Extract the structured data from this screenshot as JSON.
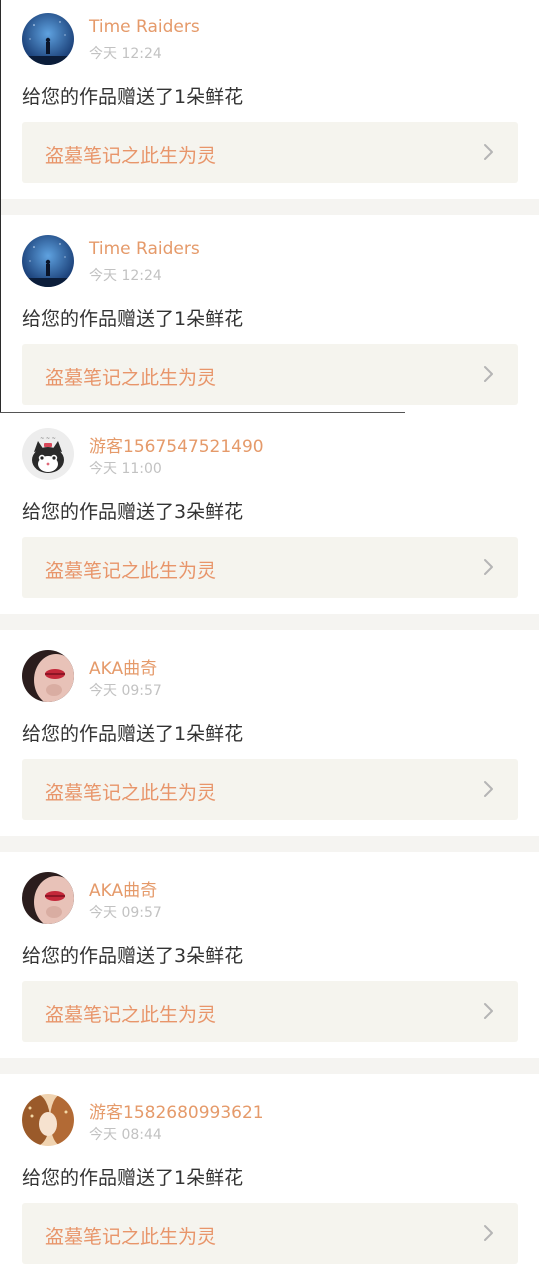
{
  "feed": {
    "items": [
      {
        "user": "Time Raiders",
        "time": "今天 12:24",
        "message": "给您的作品赠送了1朵鲜花",
        "work": "盗墓笔记之此生为灵",
        "avatar_icon": "night-sky-figure-avatar"
      },
      {
        "user": "Time Raiders",
        "time": "今天 12:24",
        "message": "给您的作品赠送了1朵鲜花",
        "work": "盗墓笔记之此生为灵",
        "avatar_icon": "night-sky-figure-avatar"
      },
      {
        "user": "游客1567547521490",
        "time": "今天 11:00",
        "message": "给您的作品赠送了3朵鲜花",
        "work": "盗墓笔记之此生为灵",
        "avatar_icon": "cartoon-cat-avatar"
      },
      {
        "user": "AKA曲奇",
        "time": "今天 09:57",
        "message": "给您的作品赠送了1朵鲜花",
        "work": "盗墓笔记之此生为灵",
        "avatar_icon": "lips-avatar"
      },
      {
        "user": "AKA曲奇",
        "time": "今天 09:57",
        "message": "给您的作品赠送了3朵鲜花",
        "work": "盗墓笔记之此生为灵",
        "avatar_icon": "lips-avatar"
      },
      {
        "user": "游客1582680993621",
        "time": "今天 08:44",
        "message": "给您的作品赠送了1朵鲜花",
        "work": "盗墓笔记之此生为灵",
        "avatar_icon": "portrait-avatar"
      }
    ]
  },
  "colors": {
    "username": "#e59a6a",
    "timestamp": "#c2c2c2",
    "message": "#333333",
    "work_title": "#e8956a",
    "work_card_bg": "#f5f4ee",
    "separator": "#f5f4f1"
  }
}
